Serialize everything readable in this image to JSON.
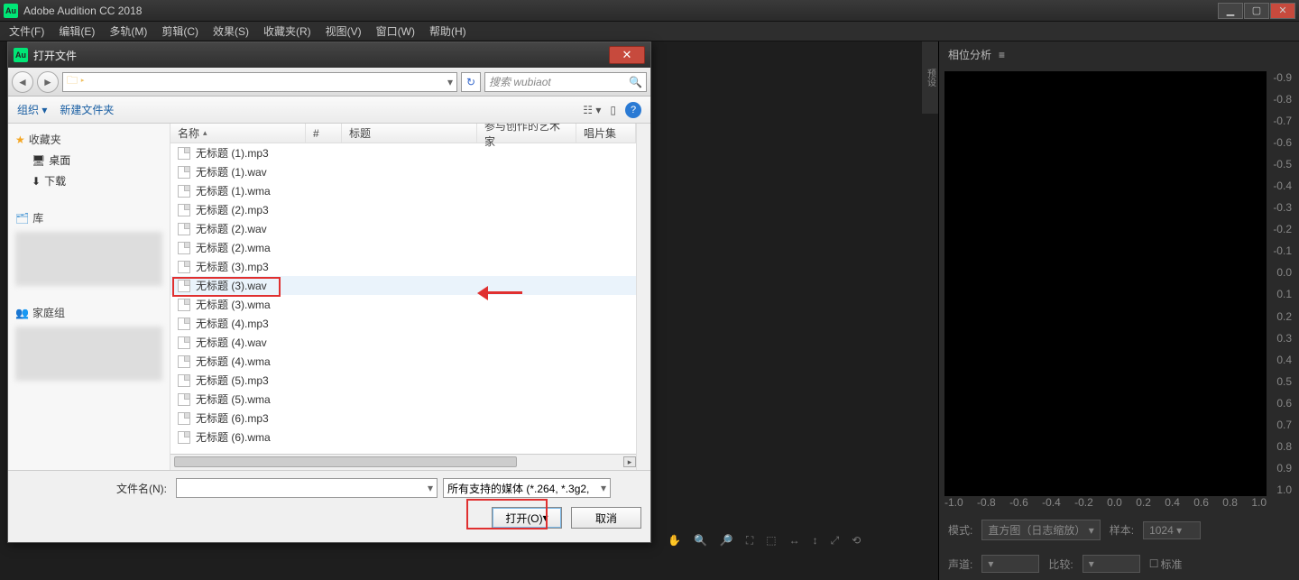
{
  "titlebar": {
    "app_name": "Adobe Audition CC 2018"
  },
  "menubar": {
    "items": [
      "文件(F)",
      "编辑(E)",
      "多轨(M)",
      "剪辑(C)",
      "效果(S)",
      "收藏夹(R)",
      "视图(V)",
      "窗口(W)",
      "帮助(H)"
    ]
  },
  "phase_panel": {
    "title": "相位分析",
    "y_ticks": [
      "-0.9",
      "-0.8",
      "-0.7",
      "-0.6",
      "-0.5",
      "-0.4",
      "-0.3",
      "-0.2",
      "-0.1",
      "0.0",
      "0.1",
      "0.2",
      "0.3",
      "0.4",
      "0.5",
      "0.6",
      "0.7",
      "0.8",
      "0.9",
      "1.0"
    ],
    "x_ticks": [
      "-1.0",
      "-0.8",
      "-0.6",
      "-0.4",
      "-0.2",
      "0.0",
      "0.2",
      "0.4",
      "0.6",
      "0.8",
      "1.0"
    ],
    "mode_label": "模式:",
    "mode_value": "直方图（日志缩放）",
    "sample_label": "样本:",
    "sample_value": "1024",
    "channel_label": "声道:",
    "channel_value": "",
    "compare_label": "比较:",
    "compare_value": "",
    "normalize_label": "标准"
  },
  "side_strip": "预设",
  "dialog": {
    "title": "打开文件",
    "search_placeholder": "搜索 wubiaot",
    "organize": "组织",
    "new_folder": "新建文件夹",
    "columns": {
      "name": "名称",
      "num": "#",
      "title": "标题",
      "artist": "参与创作的艺术家",
      "album": "唱片集"
    },
    "side": {
      "favorites": "收藏夹",
      "desktop": "桌面",
      "downloads": "下载",
      "library": "库",
      "homegroup": "家庭组"
    },
    "files": [
      "无标题 (1).mp3",
      "无标题 (1).wav",
      "无标题 (1).wma",
      "无标题 (2).mp3",
      "无标题 (2).wav",
      "无标题 (2).wma",
      "无标题 (3).mp3",
      "无标题 (3).wav",
      "无标题 (3).wma",
      "无标题 (4).mp3",
      "无标题 (4).wav",
      "无标题 (4).wma",
      "无标题 (5).mp3",
      "无标题 (5).wma",
      "无标题 (6).mp3",
      "无标题 (6).wma"
    ],
    "selected_index": 7,
    "filename_label": "文件名(N):",
    "filetype": "所有支持的媒体 (*.264, *.3g2,",
    "open_btn": "打开(O)",
    "cancel_btn": "取消"
  }
}
